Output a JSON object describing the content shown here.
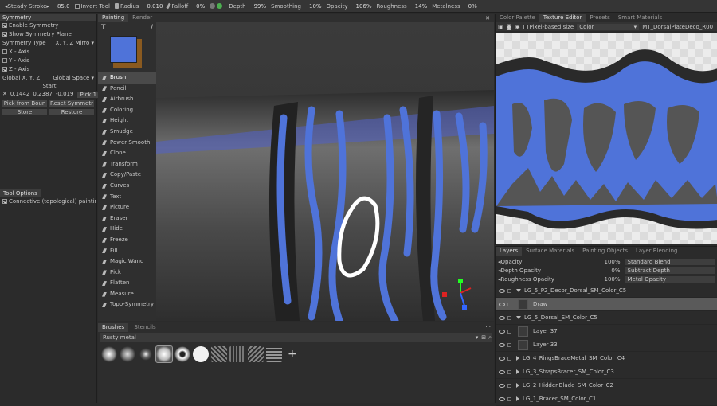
{
  "topbar": {
    "steady_stroke": {
      "label": "Steady Stroke",
      "value": "85.0"
    },
    "invert_tool": "Invert Tool",
    "radius": {
      "label": "Radius",
      "value": "0.010"
    },
    "falloff": {
      "label": "Falloff",
      "value": "0%"
    },
    "depth": {
      "label": "Depth",
      "value": "99%"
    },
    "smoothing": {
      "label": "Smoothing",
      "value": "10%"
    },
    "opacity": {
      "label": "Opacity",
      "value": "106%"
    },
    "roughness": {
      "label": "Roughness",
      "value": "14%"
    },
    "metalness": {
      "label": "Metalness",
      "value": "0%"
    }
  },
  "symmetry": {
    "title": "Symmetry",
    "enable": "Enable Symmetry",
    "show_plane": "Show Symmetry Plane",
    "type_label": "Symmetry Type",
    "type_value": "X, Y, Z Mirro",
    "x_axis": "X - Axis",
    "y_axis": "Y - Axis",
    "z_axis": "Z - Axis",
    "global_label": "Global X, Y, Z",
    "space_value": "Global Space",
    "start_label": "Start",
    "coords": [
      "0.1442",
      "0.2387",
      "-0.019"
    ],
    "pick_label": "Pick",
    "pick_bounds": "Pick from Boun",
    "reset": "Reset Symmetr",
    "store": "Store",
    "restore": "Restore"
  },
  "tool_options": {
    "title": "Tool Options",
    "connective": "Connective (topological) paintin"
  },
  "painting_tabs": [
    "Painting",
    "Render"
  ],
  "tools": [
    "Brush",
    "Pencil",
    "Airbrush",
    "Coloring",
    "Height",
    "Smudge",
    "Power Smooth",
    "Clone",
    "Transform",
    "Copy/Paste",
    "Curves",
    "Text",
    "Picture",
    "Eraser",
    "Hide",
    "Freeze",
    "Fill",
    "Magic Wand",
    "Pick",
    "Flatten",
    "Measure",
    "Topo-Symmetry"
  ],
  "brushes": {
    "tabs": [
      "Brushes",
      "Stencils"
    ],
    "preset": "Rusty metal"
  },
  "texture_editor": {
    "tabs": [
      "Color Palette",
      "Texture Editor",
      "Presets",
      "Smart Materials"
    ],
    "pixel_based": "Pixel-based size",
    "channel": "Color",
    "material": "MT_DorsalPlateDeco_R00"
  },
  "layers_panel": {
    "tabs": [
      "Layers",
      "Surface Materials",
      "Painting Objects",
      "Layer Blending"
    ],
    "props": [
      {
        "label": "Opacity",
        "value": "100%",
        "blend": "Standard Blend"
      },
      {
        "label": "Depth Opacity",
        "value": "0%",
        "blend": "Subtract Depth"
      },
      {
        "label": "Roughness Opacity",
        "value": "100%",
        "blend": "Metal Opacity"
      }
    ],
    "layers": [
      {
        "name": "LG_5_P2_Decor_Dorsal_SM_Color_C5"
      },
      {
        "name": "Draw"
      },
      {
        "name": "LG_5_Dorsal_SM_Color_C5"
      },
      {
        "name": "Layer 37"
      },
      {
        "name": "Layer 33"
      },
      {
        "name": "LG_4_RingsBraceMetal_SM_Color_C4"
      },
      {
        "name": "LG_3_StrapsBracer_SM_Color_C3"
      },
      {
        "name": "LG_2_HiddenBlade_SM_Color_C2"
      },
      {
        "name": "LG_1_Bracer_SM_Color_C1"
      }
    ]
  },
  "colors": {
    "accent": "#4f73d9",
    "panel": "#2b2b2b",
    "selection": "#5a5a5a"
  }
}
